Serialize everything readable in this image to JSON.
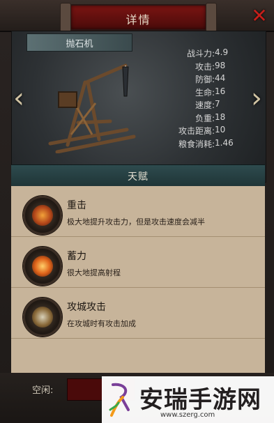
{
  "window": {
    "title": "详情",
    "close_icon": "close-x-icon"
  },
  "unit": {
    "name": "抛石机",
    "stats": [
      {
        "label": "战斗力:",
        "value": "4.9"
      },
      {
        "label": "攻击:",
        "value": "98"
      },
      {
        "label": "防御:",
        "value": "44"
      },
      {
        "label": "生命:",
        "value": "16"
      },
      {
        "label": "速度:",
        "value": "7"
      },
      {
        "label": "负重:",
        "value": "18"
      },
      {
        "label": "攻击距离:",
        "value": "10"
      },
      {
        "label": "粮食消耗:",
        "value": "1.46"
      }
    ]
  },
  "talents": {
    "header": "天赋",
    "items": [
      {
        "title": "重击",
        "desc": "极大地提升攻击力，但是攻击速度会减半",
        "icon": "heavy-strike-icon"
      },
      {
        "title": "蓄力",
        "desc": "很大地提高射程",
        "icon": "charge-icon"
      },
      {
        "title": "攻城攻击",
        "desc": "在攻城时有攻击加成",
        "icon": "siege-attack-icon"
      }
    ]
  },
  "footer": {
    "idle_label": "空闲:"
  },
  "watermark": {
    "title": "安瑞手游网",
    "url": "www.szerg.com"
  },
  "colors": {
    "accent_red": "#7a1412",
    "panel_tan": "#c7b49a",
    "header_teal": "#2e4b4e"
  }
}
